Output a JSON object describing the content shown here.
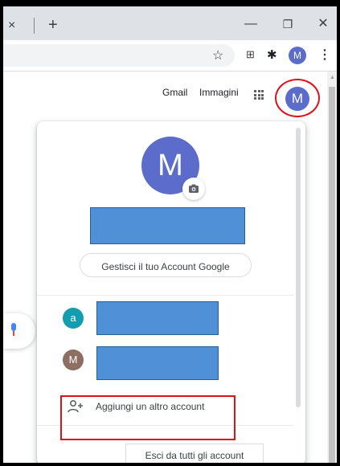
{
  "browser": {
    "tab_close_glyph": "×",
    "new_tab_glyph": "+",
    "window_min_glyph": "—",
    "window_restore_glyph": "❐",
    "window_close_glyph": "✕",
    "toolbar": {
      "bookmark_glyph": "☆",
      "qr_glyph": "⊞",
      "extensions_glyph": "✱",
      "profile_letter": "M",
      "menu_glyph": "⋮"
    }
  },
  "header": {
    "gmail_label": "Gmail",
    "images_label": "Immagini",
    "account_letter": "M"
  },
  "account_menu": {
    "avatar_letter": "M",
    "manage_label": "Gestisci il tuo Account Google",
    "accounts": [
      {
        "letter": "a",
        "color": "#129eaf"
      },
      {
        "letter": "M",
        "color": "#8d6e63"
      }
    ],
    "add_account_label": "Aggiungi un altro account",
    "sign_out_label": "Esci da tutti gli account"
  },
  "colors": {
    "avatar_blue": "#5b6ccb",
    "highlight_red": "#e0101a",
    "redaction_blue": "#4f90d7"
  }
}
